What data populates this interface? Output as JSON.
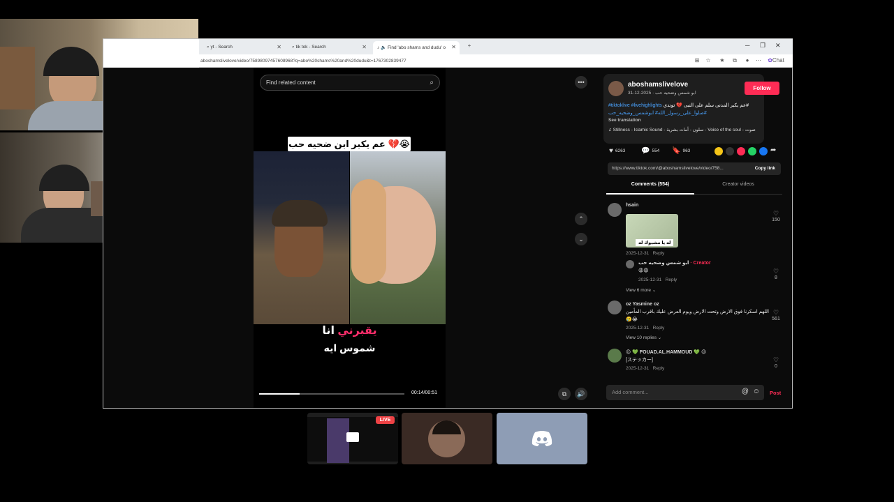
{
  "browser": {
    "tabs": [
      {
        "label": "yt - Search",
        "icon": "search-icon"
      },
      {
        "label": "tik tok - Search",
        "icon": "search-icon"
      },
      {
        "label": "Find 'abo shams and dudu' o",
        "icon": "tiktok-icon"
      }
    ],
    "url": "aboshamslivelove/video/75898097457608968?q=abo%20shams%20and%20dudu&t=1767302839477",
    "chat_label": "Chat"
  },
  "video": {
    "search_placeholder": "Find related content",
    "caption_top": "عم يكبر ابن ضحيه حب 💔😭",
    "caption_line1_pink": "يقبرني",
    "caption_line1_white": "انا",
    "caption_line2": "شموس ايه",
    "time": "00:14/00:51",
    "progress": 0.28
  },
  "post": {
    "username": "aboshamslivelove",
    "subline": "ابو شمس وضحيه حب · 2025-12-31",
    "follow_label": "Follow",
    "desc_tags": "#tiktoklive #livehighlights",
    "desc_text": "عم يكبر المدنی سلم علی النبی 💔 توندي#",
    "desc_line2": "صلوا_على_رسول_الله# ابوشمس_وضحيه_حب#",
    "see_translation": "See translation",
    "music": "♫  Stillness - Islamic Sound - سلون - أمات بشرية - Voice of the soul - صوت",
    "likes": "6263",
    "comments": "554",
    "saves": "963",
    "link": "https://www.tiktok.com/@aboshamslivelove/video/758...",
    "copy_link": "Copy link",
    "tab_comments": "Comments (554)",
    "tab_creator": "Creator videos"
  },
  "comments": [
    {
      "name": "hsain",
      "sticker_caption": "له يا مشيوك له",
      "date": "2025-12-31",
      "reply": "Reply",
      "likes": "150"
    },
    {
      "name": "ابو شمس وضحيه حب",
      "creator": "· Creator",
      "text": "😩😩",
      "date": "2025-12-31",
      "reply": "Reply",
      "likes": "8",
      "view_more": "View 6 more"
    },
    {
      "name": "oz Yasmine oz",
      "text": "اللهم اسكرنا فوق الارض وتحت الارض ويوم العرض عليك باقرب المأمين",
      "text2": "🥲😭",
      "date": "2025-12-31",
      "reply": "Reply",
      "likes": "561",
      "view_more": "View 10 replies"
    },
    {
      "name": "😍 💚 FOUAD.AL.HAMMOUD 💚 😍",
      "text": "[ステッカー]",
      "date": "2025-12-31",
      "reply": "Reply",
      "likes": "0"
    }
  ],
  "composer": {
    "placeholder": "Add comment...",
    "post_label": "Post"
  },
  "discord": {
    "live_label": "LIVE"
  },
  "colors": {
    "accent": "#fe2c55",
    "link": "#4aa3ff",
    "discord_tile": "#8e9db5"
  }
}
